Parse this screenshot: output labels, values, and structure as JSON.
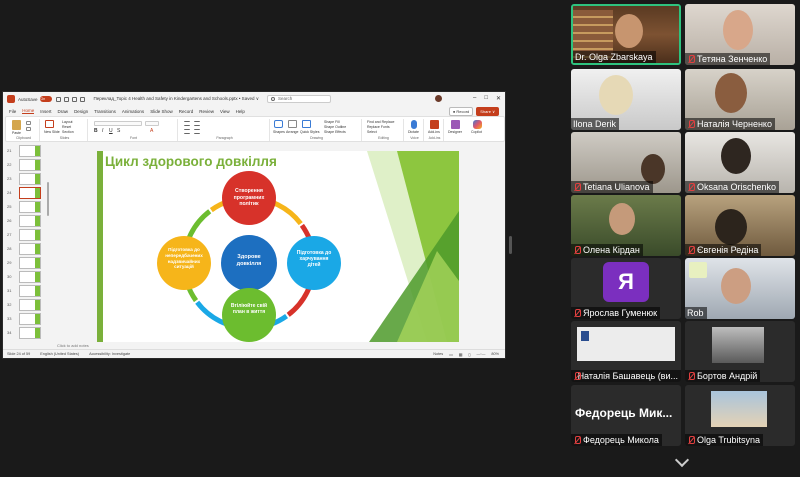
{
  "ppt": {
    "autosave_label": "AutoSave",
    "autosave_state": "On",
    "doc_title": "Переклад_Topic 4 Health and Safety in Kindergartens and Schools.pptx • Saved ∨",
    "search_placeholder": "Search",
    "tabs": [
      "File",
      "Home",
      "Insert",
      "Draw",
      "Design",
      "Transitions",
      "Animations",
      "Slide Show",
      "Record",
      "Review",
      "View",
      "Help"
    ],
    "active_tab": "Home",
    "record_button": "Record",
    "share_button": "Share",
    "ribbon": {
      "clipboard": "Clipboard",
      "paste": "Paste",
      "slides": "Slides",
      "new_slide": "New Slide",
      "layout": "Layout",
      "reset": "Reset",
      "section": "Section",
      "font": "Font",
      "paragraph": "Paragraph",
      "drawing": "Drawing",
      "shapes": "Shapes",
      "arrange": "Arrange",
      "quick_styles": "Quick Styles",
      "shape_fill": "Shape Fill",
      "shape_outline": "Shape Outline",
      "shape_effects": "Shape Effects",
      "editing": "Editing",
      "find_replace": "Find and Replace",
      "replace_fonts": "Replace Fonts",
      "select": "Select",
      "voice": "Voice",
      "dictate": "Dictate",
      "addins": "Add-ins",
      "addins_btn": "Add-ins",
      "designer": "Designer",
      "copilot": "Copilot"
    },
    "thumbnails": [
      "21",
      "22",
      "23",
      "24",
      "25",
      "26",
      "27",
      "28",
      "29",
      "30",
      "31",
      "32",
      "33",
      "34"
    ],
    "selected_thumbnail": "24",
    "slide": {
      "title": "Цикл здорового довкілля",
      "center": "Здорове довкілля",
      "nodes": {
        "top": "Створення програмних політик",
        "right": "Підготовка до харчування дітей",
        "bottom": "Втіліюйте свій план в життя",
        "left": "Підготовка до непередбачених надзвичайних ситуацій"
      }
    },
    "notes_placeholder": "Click to add notes",
    "status": {
      "slide_info": "Slide 24 of 59",
      "language": "English (United States)",
      "accessibility": "Accessibility: Investigate",
      "notes": "Notes",
      "zoom": "80%"
    }
  },
  "colors": {
    "ppt_accent": "#c43e1c",
    "slide_green": "#7ab03a",
    "node_red": "#d7322a",
    "node_blue": "#1aa8e6",
    "node_green": "#6cbd2f",
    "node_yellow": "#f6b51a",
    "center_blue": "#1d6fc0",
    "mic_off": "#e04040",
    "active_speaker": "#2ec27e"
  },
  "participants": [
    {
      "name": "Dr. Olga Zbarskaya",
      "muted": false,
      "active": true
    },
    {
      "name": "Тетяна Зенченко",
      "muted": true
    },
    {
      "name": "Ilona Derik",
      "muted": true
    },
    {
      "name": "Наталія Черненко",
      "muted": true
    },
    {
      "name": "Tetiana Ulianova",
      "muted": true
    },
    {
      "name": "Oksana Orischenko",
      "muted": true
    },
    {
      "name": "Олена Кірдан",
      "muted": true
    },
    {
      "name": "Євгенія Редіна",
      "muted": true
    },
    {
      "name": "Ярослав Гуменюк",
      "muted": true,
      "initial": "Я"
    },
    {
      "name": "Rob",
      "muted": false
    },
    {
      "name": "Наталія Башавець (ви...",
      "muted": true
    },
    {
      "name": "Бортов Андрій",
      "muted": true
    },
    {
      "name": "Федорець Микола",
      "muted": true,
      "big_label": "Федорець Мик..."
    },
    {
      "name": "Olga Trubitsyna",
      "muted": true
    }
  ]
}
